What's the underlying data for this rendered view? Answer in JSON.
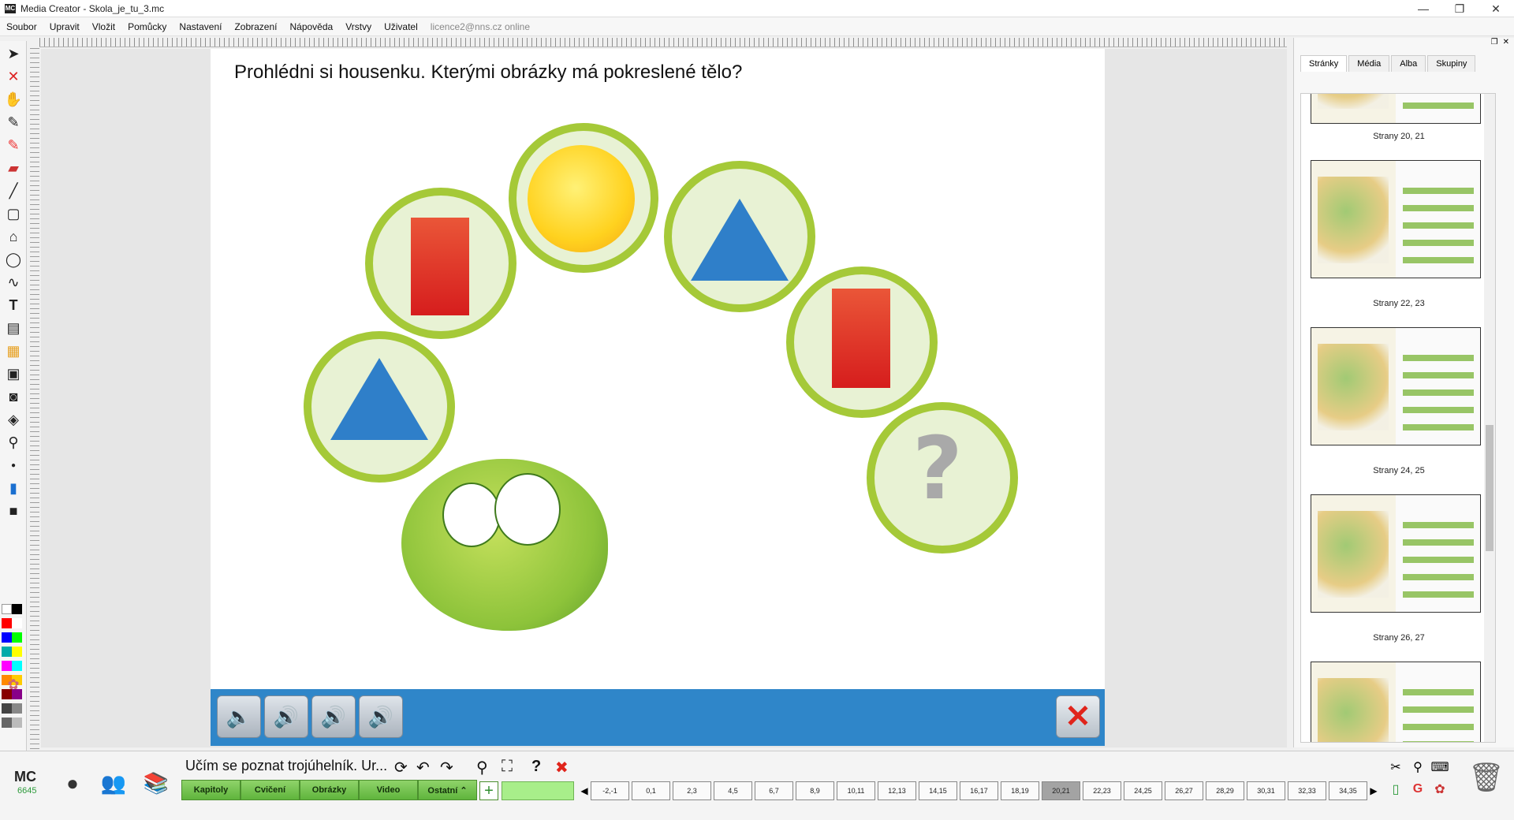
{
  "window": {
    "title": "Media Creator - Skola_je_tu_3.mc",
    "logo": "MC"
  },
  "menu": [
    "Soubor",
    "Upravit",
    "Vložit",
    "Pomůcky",
    "Nastavení",
    "Zobrazení",
    "Nápověda",
    "Vrstvy",
    "Uživatel"
  ],
  "status": "licence2@nns.cz online",
  "page": {
    "question": "Prohlédni si housenku. Kterými obrázky má pokreslené tělo?",
    "question_mark": "?"
  },
  "right_panel": {
    "tabs": [
      "Stránky",
      "Média",
      "Alba",
      "Skupiny"
    ],
    "active_tab": "Stránky",
    "thumbs": [
      "Strany 20, 21",
      "Strany 22, 23",
      "Strany 24, 25",
      "Strany 26, 27"
    ]
  },
  "bottom": {
    "logo": "MC",
    "number": "6645",
    "book_title": "Učím se poznat trojúhelník. Ur...",
    "buttons": [
      "Kapitoly",
      "Cvičení",
      "Obrázky",
      "Video",
      "Ostatní ⌃"
    ],
    "pages": [
      "-2,-1",
      "0,1",
      "2,3",
      "4,5",
      "6,7",
      "8,9",
      "10,11",
      "12,13",
      "14,15",
      "16,17",
      "18,19",
      "20,21",
      "22,23",
      "24,25",
      "26,27",
      "28,29",
      "30,31",
      "32,33",
      "34,35"
    ],
    "active_page": "20,21"
  },
  "colors": {
    "accent_green": "#a5c938",
    "bar_blue": "#2f86c9",
    "rect_red": "#e0301f",
    "tri_blue": "#2f7fc9"
  }
}
